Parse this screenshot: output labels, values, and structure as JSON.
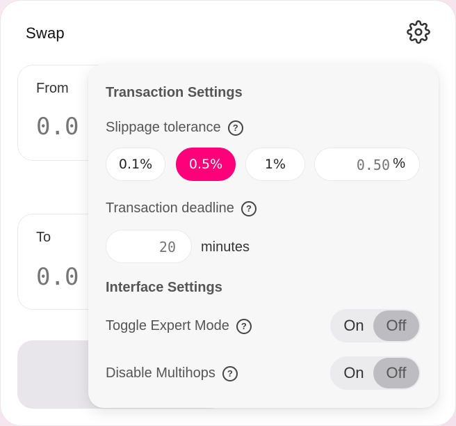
{
  "swap": {
    "title": "Swap",
    "from_label": "From",
    "from_amount_placeholder": "0.0",
    "to_label": "To",
    "to_amount_placeholder": "0.0"
  },
  "settings": {
    "transaction_heading": "Transaction Settings",
    "slippage_label": "Slippage tolerance",
    "slippage_options": [
      "0.1%",
      "0.5%",
      "1%"
    ],
    "slippage_selected": "0.5%",
    "slippage_custom_placeholder": "0.50",
    "slippage_custom_suffix": "%",
    "deadline_label": "Transaction deadline",
    "deadline_placeholder": "20",
    "deadline_unit": "minutes",
    "interface_heading": "Interface Settings",
    "expert_mode_label": "Toggle Expert Mode",
    "expert_mode": {
      "on": "On",
      "off": "Off",
      "selected": "Off"
    },
    "multihops_label": "Disable Multihops",
    "multihops": {
      "on": "On",
      "off": "Off",
      "selected": "Off"
    },
    "help_glyph": "?"
  },
  "colors": {
    "accent": "#ff007a",
    "panel_bg": "#f7f7f8",
    "toggle_selected": "#bdbdc1"
  },
  "icons": {
    "settings": "gear-icon",
    "help": "question-circle-icon"
  }
}
